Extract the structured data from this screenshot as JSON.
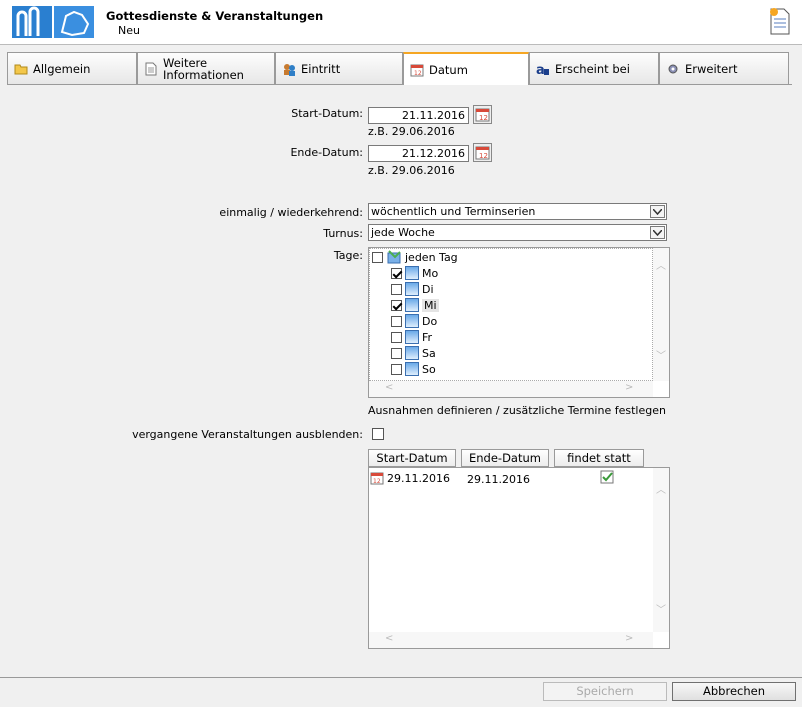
{
  "header": {
    "title": "Gottesdienste & Veranstaltungen",
    "subtitle": "Neu"
  },
  "tabs": [
    {
      "label": "Allgemein",
      "icon": "folder-icon"
    },
    {
      "label": "Weitere Informationen",
      "icon": "document-icon"
    },
    {
      "label": "Eintritt",
      "icon": "users-icon"
    },
    {
      "label": "Datum",
      "icon": "calendar-icon",
      "active": true
    },
    {
      "label": "Erscheint bei",
      "icon": "text-a-icon"
    },
    {
      "label": "Erweitert",
      "icon": "gear-icon"
    }
  ],
  "form": {
    "start_label": "Start-Datum:",
    "start_value": "21.11.2016",
    "start_hint": "z.B. 29.06.2016",
    "end_label": "Ende-Datum:",
    "end_value": "21.12.2016",
    "end_hint": "z.B. 29.06.2016",
    "recurrence_label": "einmalig / wiederkehrend:",
    "recurrence_value": "wöchentlich und Terminserien",
    "turnus_label": "Turnus:",
    "turnus_value": "jede Woche",
    "days_label": "Tage:",
    "days_root": "jeden Tag",
    "days": [
      {
        "label": "Mo",
        "checked": true
      },
      {
        "label": "Di",
        "checked": false
      },
      {
        "label": "Mi",
        "checked": true
      },
      {
        "label": "Do",
        "checked": false
      },
      {
        "label": "Fr",
        "checked": false
      },
      {
        "label": "Sa",
        "checked": false
      },
      {
        "label": "So",
        "checked": false
      }
    ],
    "exceptions_link": "Ausnahmen definieren / zusätzliche Termine festlegen",
    "hide_past_label": "vergangene Veranstaltungen ausblenden:"
  },
  "grid": {
    "columns": [
      "Start-Datum",
      "Ende-Datum",
      "findet statt"
    ],
    "rows": [
      {
        "start": "29.11.2016",
        "end": "29.11.2016",
        "takes_place": true
      }
    ]
  },
  "footer": {
    "save_label": "Speichern",
    "cancel_label": "Abbrechen"
  }
}
